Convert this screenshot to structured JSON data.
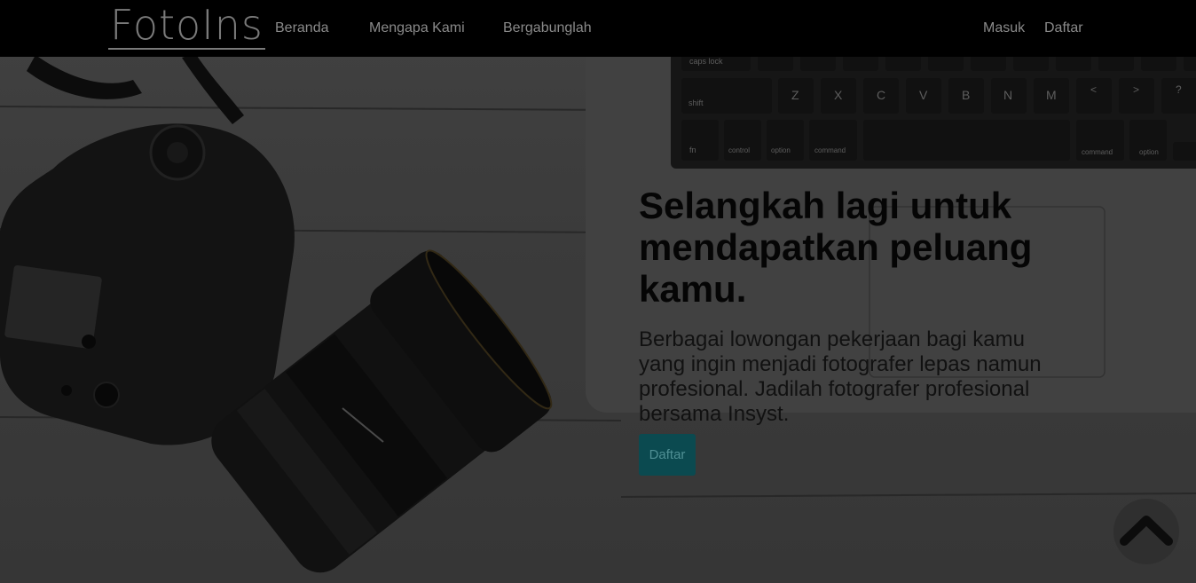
{
  "navbar": {
    "brand": "FotoIns",
    "links": [
      "Beranda",
      "Mengapa Kami",
      "Bergabunglah"
    ],
    "login": "Masuk",
    "register": "Daftar"
  },
  "hero": {
    "headline": "Selangkah lagi untuk mendapatkan peluang kamu.",
    "subtext": "Berbagai lowongan pekerjaan bagi kamu yang ingin menjadi fotografer lepas namun profesional. Jadilah fotografer profesional bersama Insyst.",
    "cta_label": "Daftar"
  },
  "keyboard": {
    "row1": [
      "caps lock"
    ],
    "row2": [
      "shift",
      "Z",
      "X",
      "C",
      "V",
      "B",
      "N",
      "M",
      "<",
      ">",
      "?"
    ],
    "row3": [
      "fn",
      "control",
      "option",
      "command",
      "command",
      "option"
    ]
  },
  "colors": {
    "navbar": "#000000",
    "cta": "#0b4a50"
  },
  "icons": {
    "scroll_top": "chevron-up-icon"
  }
}
